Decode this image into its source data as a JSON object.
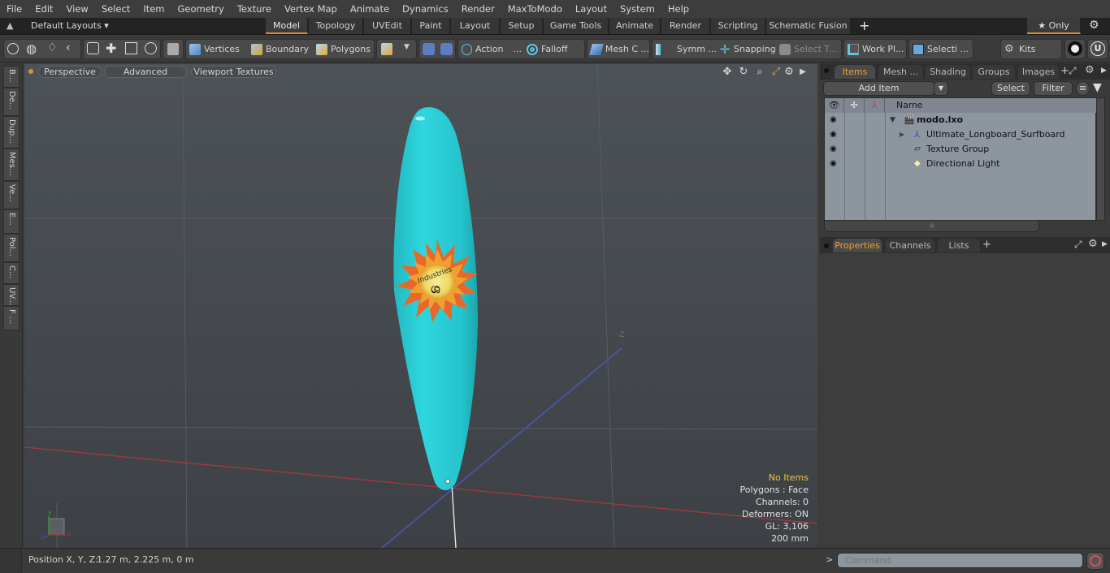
{
  "menu": [
    "File",
    "Edit",
    "View",
    "Select",
    "Item",
    "Geometry",
    "Texture",
    "Vertex Map",
    "Animate",
    "Dynamics",
    "Render",
    "MaxToModo",
    "Layout",
    "System",
    "Help"
  ],
  "layout_bar": {
    "layouts_label": "Default Layouts ▾",
    "tabs": [
      "Model",
      "Topology",
      "UVEdit",
      "Paint",
      "Layout",
      "Setup",
      "Game Tools",
      "Animate",
      "Render",
      "Scripting",
      "Schematic Fusion"
    ],
    "active_tab": "Model",
    "add_tab": "+",
    "only_label": "★ Only"
  },
  "toolbar": {
    "vertices": "Vertices",
    "boundary": "Boundary",
    "polygons": "Polygons",
    "action": "Action",
    "action_more": "...",
    "falloff": "Falloff",
    "mesh_c": "Mesh C ...",
    "symm": "Symm ...",
    "snapping": "Snapping",
    "select_t": "Select T...",
    "work_pl": "Work Pl...",
    "selecti": "Selecti ...",
    "kits": "Kits"
  },
  "left_tabs": [
    "B...",
    "De...",
    "Dup...",
    "Mes...",
    "Ve...",
    "E...",
    "Pol...",
    "C...",
    "UV...",
    "F ..."
  ],
  "viewport": {
    "perspective": "Perspective",
    "advanced": "Advanced",
    "viewport_textures": "Viewport Textures",
    "axis_label_z": "-Z",
    "logo_text": "Industries",
    "hud": {
      "selection": "No Items",
      "polygons": "Polygons : Face",
      "channels": "Channels: 0",
      "deformers": "Deformers: ON",
      "gl": "GL: 3,106",
      "grid": "200 mm"
    },
    "accent_color": "#f0c040",
    "board_color": "#28cdd6"
  },
  "items_panel": {
    "tabs": [
      "Items",
      "Mesh ...",
      "Shading",
      "Groups",
      "Images"
    ],
    "active_tab": "Items",
    "add_item": "Add Item",
    "select": "Select",
    "filter": "Filter",
    "name_header": "Name",
    "rows": [
      {
        "name": "modo.lxo",
        "bold": true
      },
      {
        "name": "Ultimate_Longboard_Surfboard"
      },
      {
        "name": "Texture Group"
      },
      {
        "name": "Directional Light"
      }
    ]
  },
  "properties_panel": {
    "tabs": [
      "Properties",
      "Channels",
      "Lists"
    ],
    "active_tab": "Properties",
    "add": "+"
  },
  "status": {
    "position_label": "Position X, Y, Z:",
    "position_value": "1.27 m, 2.225 m, 0 m"
  },
  "command": {
    "prompt": ">",
    "placeholder": "Command"
  }
}
